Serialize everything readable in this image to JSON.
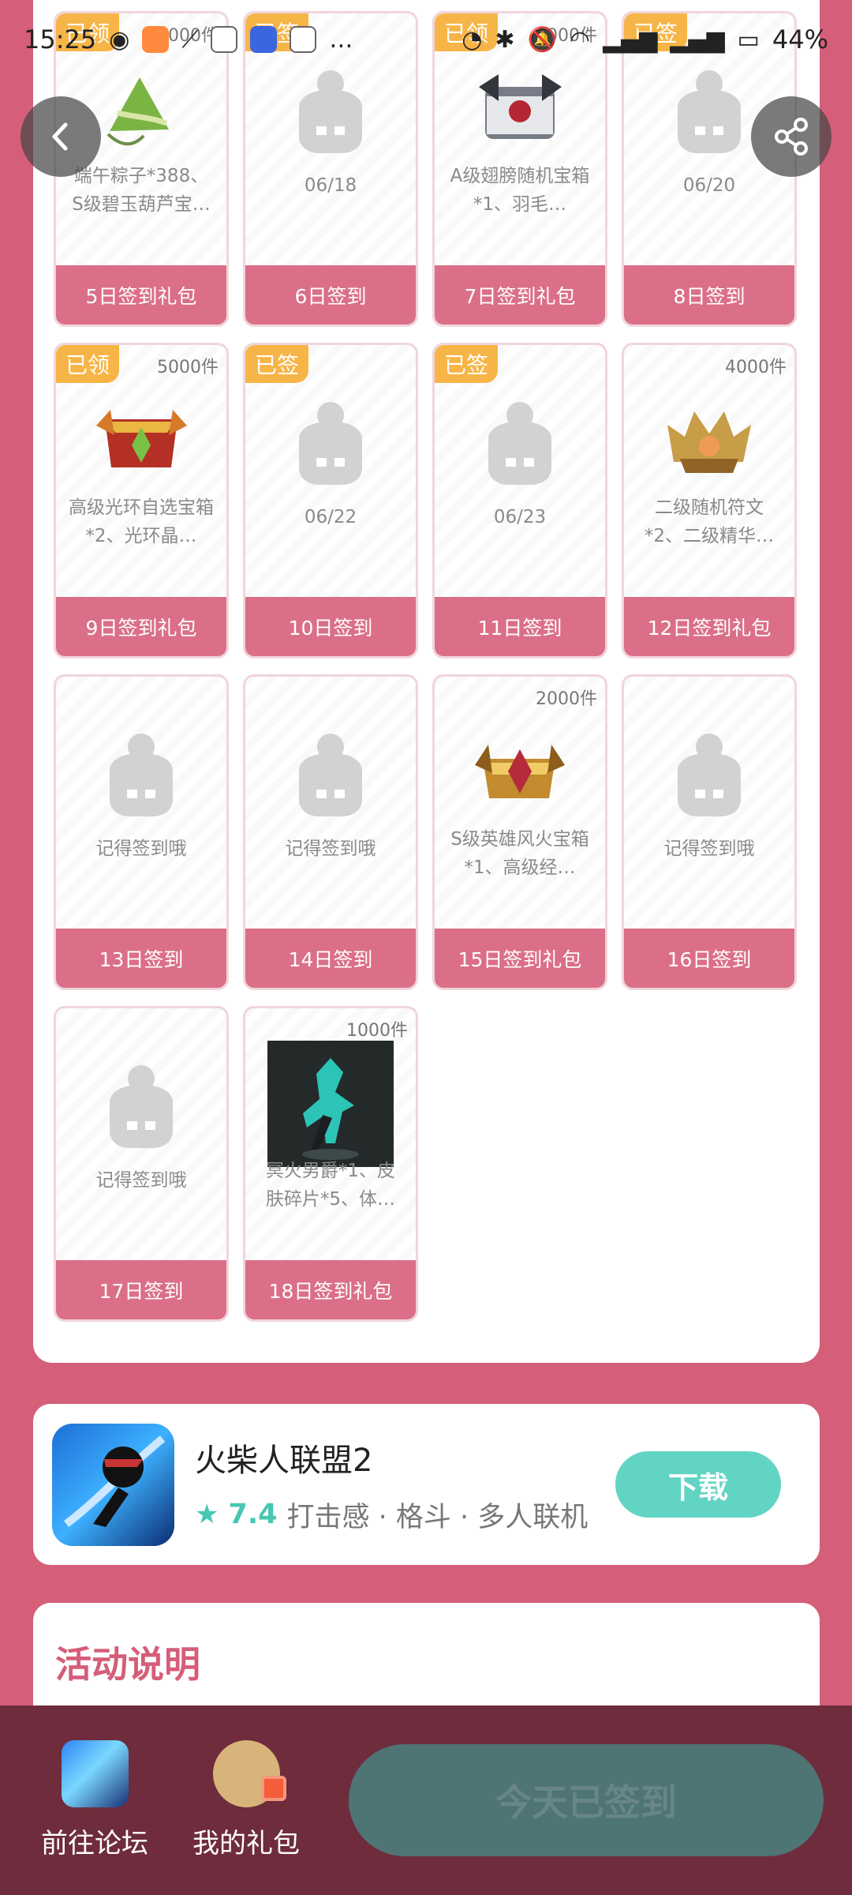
{
  "status": {
    "time": "15:25",
    "battery": "44%"
  },
  "cards": [
    {
      "badge": "已领",
      "count": "7000件",
      "desc": "端午粽子*388、S级碧玉葫芦宝…",
      "footer": "5日签到礼包",
      "image": "zongzi-icon"
    },
    {
      "badge": "已签",
      "count": "",
      "desc": "06/18",
      "footer": "6日签到",
      "image": "mascot-icon"
    },
    {
      "badge": "已领",
      "count": "6000件",
      "desc": "A级翅膀随机宝箱*1、羽毛…",
      "footer": "7日签到礼包",
      "image": "treasure-chest-icon"
    },
    {
      "badge": "已签",
      "count": "",
      "desc": "06/20",
      "footer": "8日签到",
      "image": "mascot-icon"
    },
    {
      "badge": "已领",
      "count": "5000件",
      "desc": "高级光环自选宝箱*2、光环晶…",
      "footer": "9日签到礼包",
      "image": "halo-chest-icon"
    },
    {
      "badge": "已签",
      "count": "",
      "desc": "06/22",
      "footer": "10日签到",
      "image": "mascot-icon"
    },
    {
      "badge": "已签",
      "count": "",
      "desc": "06/23",
      "footer": "11日签到",
      "image": "mascot-icon"
    },
    {
      "badge": "",
      "count": "4000件",
      "desc": "二级随机符文*2、二级精华…",
      "footer": "12日签到礼包",
      "image": "rune-crown-icon"
    },
    {
      "badge": "",
      "count": "",
      "desc": "记得签到哦",
      "footer": "13日签到",
      "image": "mascot-icon"
    },
    {
      "badge": "",
      "count": "",
      "desc": "记得签到哦",
      "footer": "14日签到",
      "image": "mascot-icon"
    },
    {
      "badge": "",
      "count": "2000件",
      "desc": "S级英雄风火宝箱*1、高级经…",
      "footer": "15日签到礼包",
      "image": "hero-chest-icon"
    },
    {
      "badge": "",
      "count": "",
      "desc": "记得签到哦",
      "footer": "16日签到",
      "image": "mascot-icon"
    },
    {
      "badge": "",
      "count": "",
      "desc": "记得签到哦",
      "footer": "17日签到",
      "image": "mascot-icon"
    },
    {
      "badge": "",
      "count": "1000件",
      "desc": "冥火男爵*1、皮肤碎片*5、体…",
      "footer": "18日签到礼包",
      "image": "character-skin-icon"
    }
  ],
  "game": {
    "name": "火柴人联盟2",
    "rating": "7.4",
    "tags": "打击感 · 格斗 · 多人联机",
    "download_label": "下载",
    "icon": "stickman-game-icon"
  },
  "activity": {
    "title": "活动说明"
  },
  "bottom": {
    "forum_label": "前往论坛",
    "gift_label": "我的礼包",
    "signed_label": "今天已签到"
  },
  "colors": {
    "background": "#d55e79",
    "card_footer": "#db6f87",
    "badge": "#f7b547",
    "download": "#62d4c3",
    "bottom_bar": "#6e2c3d",
    "signed_button": "#4e7474"
  }
}
